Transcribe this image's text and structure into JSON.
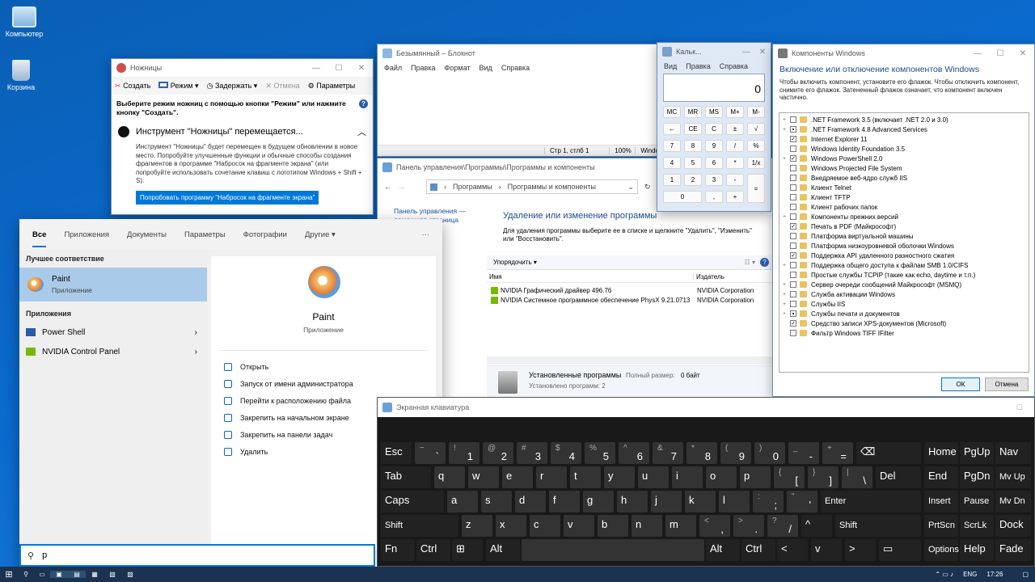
{
  "desktop": {
    "icons": [
      {
        "label": "Компьютер"
      },
      {
        "label": "Корзина"
      }
    ]
  },
  "snip": {
    "title": "Ножницы",
    "new": "Создать",
    "mode": "Режим",
    "delay": "Задержать",
    "cancel": "Отмена",
    "options": "Параметры",
    "hint": "Выберите режим ножниц с помощью кнопки \"Режим\" или нажмите кнопку \"Создать\".",
    "notice_title": "Инструмент \"Ножницы\" перемещается...",
    "notice_body": "Инструмент \"Ножницы\" будет перемещен в будущем обновлении в новое место. Попробуйте улучшенные функции и обычные способы создания фрагментов в программе \"Набросок на фрагменте экрана\" (или попробуйте использовать сочетание клавиш с логотипом Windows + Shift + S).",
    "try_btn": "Попробовать программу \"Набросок на фрагменте экрана\""
  },
  "notepad": {
    "title": "Безымянный – Блокнот",
    "menu": [
      "Файл",
      "Правка",
      "Формат",
      "Вид",
      "Справка"
    ],
    "status": {
      "pos": "Стр 1, стлб 1",
      "zoom": "100%",
      "enc": "Windo"
    }
  },
  "calc": {
    "title": "Кальк...",
    "menu": [
      "Вид",
      "Правка",
      "Справка"
    ],
    "display": "0",
    "keys": [
      "MC",
      "MR",
      "MS",
      "M+",
      "M-",
      "←",
      "CE",
      "C",
      "±",
      "√",
      "7",
      "8",
      "9",
      "/",
      "%",
      "4",
      "5",
      "6",
      "*",
      "1/x",
      "1",
      "2",
      "3",
      "-",
      "=",
      "0",
      ",",
      "+"
    ]
  },
  "features": {
    "title": "Компоненты Windows",
    "heading": "Включение или отключение компонентов Windows",
    "desc": "Чтобы включить компонент, установите его флажок. Чтобы отключить компонент, снимите его флажок. Затененный флажок означает, что компонент включен частично.",
    "items": [
      {
        "label": ".NET Framework 3.5 (включает .NET 2.0 и 3.0)",
        "exp": "+",
        "state": "off"
      },
      {
        "label": ".NET Framework 4.8 Advanced Services",
        "exp": "+",
        "state": "part"
      },
      {
        "label": "Internet Explorer 11",
        "exp": "",
        "state": "on"
      },
      {
        "label": "Windows Identity Foundation 3.5",
        "exp": "",
        "state": "off"
      },
      {
        "label": "Windows PowerShell 2.0",
        "exp": "+",
        "state": "on"
      },
      {
        "label": "Windows Projected File System",
        "exp": "",
        "state": "off"
      },
      {
        "label": "Внедряемое веб-ядро служб IIS",
        "exp": "",
        "state": "off"
      },
      {
        "label": "Клиент Telnet",
        "exp": "",
        "state": "off"
      },
      {
        "label": "Клиент TFTP",
        "exp": "",
        "state": "off"
      },
      {
        "label": "Клиент рабочих папок",
        "exp": "",
        "state": "off"
      },
      {
        "label": "Компоненты прежних версий",
        "exp": "+",
        "state": "off"
      },
      {
        "label": "Печать в PDF (Майкрософт)",
        "exp": "",
        "state": "on"
      },
      {
        "label": "Платформа виртуальной машины",
        "exp": "",
        "state": "off"
      },
      {
        "label": "Платформа низкоуровневой оболочки Windows",
        "exp": "",
        "state": "off"
      },
      {
        "label": "Поддержка API удаленного разностного сжатия",
        "exp": "",
        "state": "on"
      },
      {
        "label": "Поддержка общего доступа к файлам SMB 1.0/CIFS",
        "exp": "+",
        "state": "off"
      },
      {
        "label": "Простые службы TCPIP (такие как echo, daytime и т.п.)",
        "exp": "",
        "state": "off"
      },
      {
        "label": "Сервер очереди сообщений Майкрософт (MSMQ)",
        "exp": "+",
        "state": "off"
      },
      {
        "label": "Служба активации Windows",
        "exp": "+",
        "state": "off"
      },
      {
        "label": "Службы IIS",
        "exp": "+",
        "state": "off"
      },
      {
        "label": "Службы печати и документов",
        "exp": "+",
        "state": "part"
      },
      {
        "label": "Средство записи XPS-документов (Microsoft)",
        "exp": "",
        "state": "on"
      },
      {
        "label": "Фильтр Windows TIFF IFilter",
        "exp": "",
        "state": "off"
      }
    ],
    "ok": "ОК",
    "cancel": "Отмена"
  },
  "cpanel": {
    "title": "Панель управления\\Программы\\Программы и компоненты",
    "crumb1": "Программы",
    "crumb2": "Программы и компоненты",
    "side": [
      "Панель управления — домашняя страница",
      "ленных",
      "ключение",
      "ndows"
    ],
    "heading": "Удаление или изменение программы",
    "desc": "Для удаления программы выберите ее в списке и щелкните \"Удалить\", \"Изменить\" или \"Восстановить\".",
    "organize": "Упорядочить",
    "col_name": "Имя",
    "col_pub": "Издатель",
    "rows": [
      {
        "name": "NVIDIA Графический драйвер 496.76",
        "pub": "NVIDIA Corporation"
      },
      {
        "name": "NVIDIA Системное программное обеспечение PhysX 9.21.0713",
        "pub": "NVIDIA Corporation"
      }
    ],
    "footer_title": "Установленные программы",
    "footer_size_label": "Полный размер:",
    "footer_size": "0 байт",
    "footer_count": "Установлено программ: 2"
  },
  "start": {
    "tabs": [
      "Все",
      "Приложения",
      "Документы",
      "Параметры",
      "Фотографии",
      "Другие"
    ],
    "dots": "···",
    "best_header": "Лучшее соответствие",
    "best_name": "Paint",
    "best_type": "Приложение",
    "apps_header": "Приложения",
    "apps": [
      "Power Shell",
      "NVIDIA Control Panel"
    ],
    "detail_name": "Paint",
    "detail_type": "Приложение",
    "actions": [
      "Открыть",
      "Запуск от имени администратора",
      "Перейти к расположению файла",
      "Закрепить на начальном экране",
      "Закрепить на панели задач",
      "Удалить"
    ],
    "query": "p"
  },
  "osk": {
    "title": "Экранная клавиатура"
  },
  "taskbar": {
    "lang": "ENG",
    "time": "17:26"
  },
  "colors": {
    "accent": "#0078d7",
    "desktop": "#0b6bd0",
    "osk_bg": "#191919",
    "osk_key": "#333333"
  }
}
